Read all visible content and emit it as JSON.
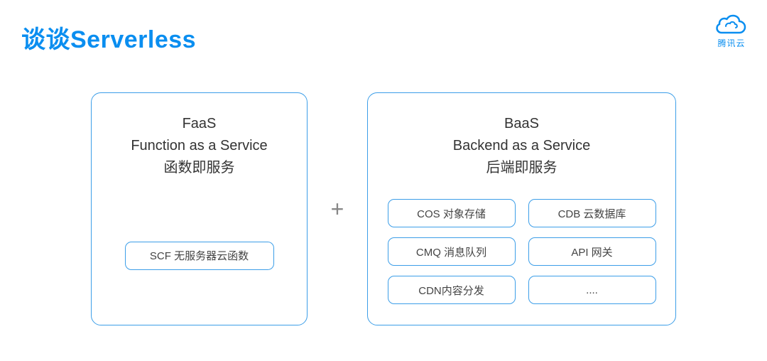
{
  "title": "谈谈Serverless",
  "brand": {
    "label": "腾讯云"
  },
  "plus": "+",
  "faas": {
    "t1": "FaaS",
    "t2": "Function as a Service",
    "t3": "函数即服务",
    "items": [
      "SCF 无服务器云函数"
    ]
  },
  "baas": {
    "t1": "BaaS",
    "t2": "Backend as a Service",
    "t3": "后端即服务",
    "items": [
      "COS 对象存储",
      "CDB 云数据库",
      "CMQ 消息队列",
      "API 网关",
      "CDN内容分发",
      "...."
    ]
  }
}
